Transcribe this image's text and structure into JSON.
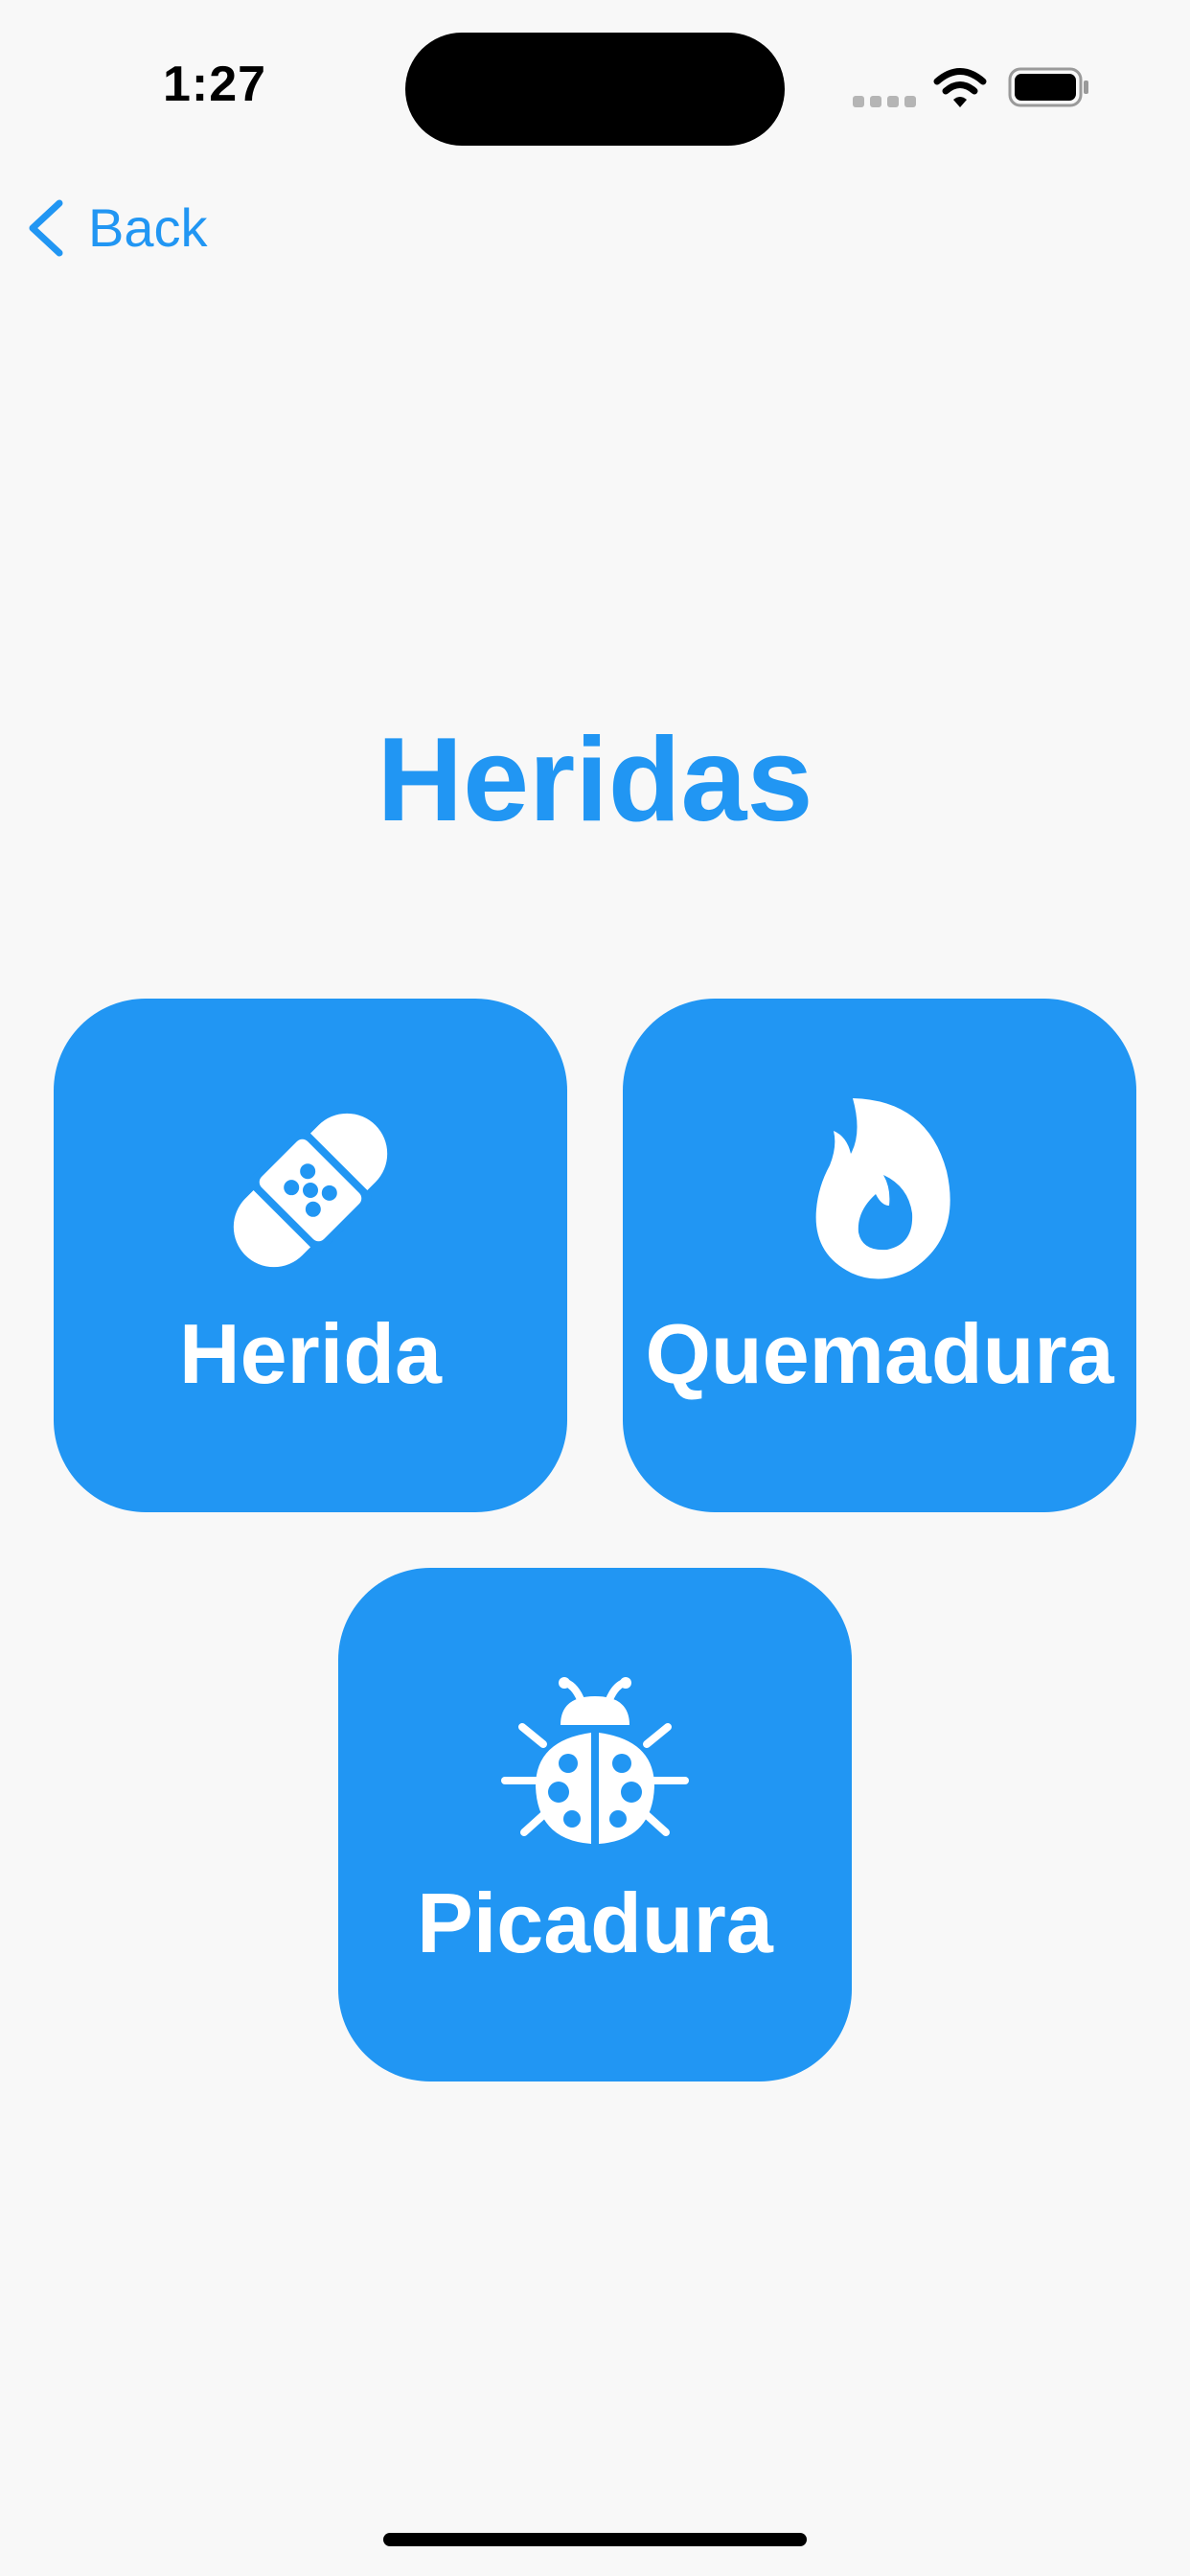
{
  "status_bar": {
    "time": "1:27"
  },
  "nav": {
    "back_label": "Back"
  },
  "page": {
    "title": "Heridas"
  },
  "tiles": [
    {
      "label": "Herida",
      "icon": "bandage-icon"
    },
    {
      "label": "Quemadura",
      "icon": "flame-icon"
    },
    {
      "label": "Picadura",
      "icon": "ladybug-icon"
    }
  ],
  "colors": {
    "accent": "#2196f3",
    "background": "#f8f8f8",
    "tile_text": "#ffffff"
  }
}
